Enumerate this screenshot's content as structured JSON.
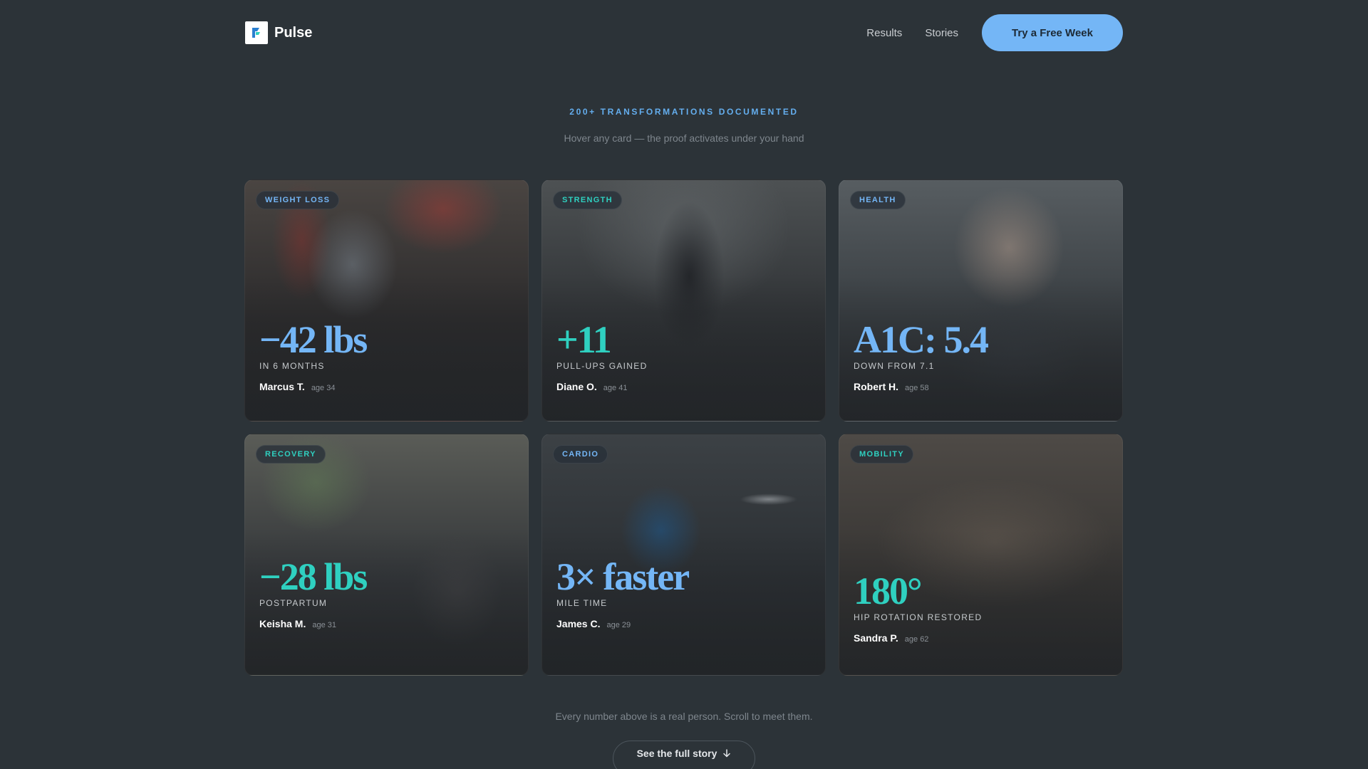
{
  "brand": {
    "name": "Pulse"
  },
  "nav": {
    "links": [
      "Results",
      "Stories"
    ],
    "cta_label": "Try a Free Week"
  },
  "hero": {
    "eyebrow": "200+ TRANSFORMATIONS DOCUMENTED",
    "subline": "Hover any card — the proof activates under your hand"
  },
  "cards": [
    {
      "tag": "WEIGHT LOSS",
      "stat": "−42 lbs",
      "caption": "IN 6 MONTHS",
      "name": "Marcus T.",
      "age": "age 34"
    },
    {
      "tag": "STRENGTH",
      "stat": "+11",
      "caption": "PULL-UPS GAINED",
      "name": "Diane O.",
      "age": "age 41"
    },
    {
      "tag": "HEALTH",
      "stat": "A1C: 5.4",
      "caption": "DOWN FROM 7.1",
      "name": "Robert H.",
      "age": "age 58"
    },
    {
      "tag": "RECOVERY",
      "stat": "−28 lbs",
      "caption": "POSTPARTUM",
      "name": "Keisha M.",
      "age": "age 31"
    },
    {
      "tag": "CARDIO",
      "stat": "3× faster",
      "caption": "MILE TIME",
      "name": "James C.",
      "age": "age 29"
    },
    {
      "tag": "MOBILITY",
      "stat": "180°",
      "caption": "HIP ROTATION RESTORED",
      "name": "Sandra P.",
      "age": "age 62"
    }
  ],
  "footer": {
    "note": "Every number above is a real person. Scroll to meet them.",
    "button_label": "See the full story"
  },
  "icons": {
    "logo": "pulse-logo-icon",
    "arrow": "arrow-down-icon"
  },
  "colors": {
    "accent_blue": "#74b6f6",
    "accent_teal": "#2fd0c0",
    "background": "#2c3338"
  }
}
